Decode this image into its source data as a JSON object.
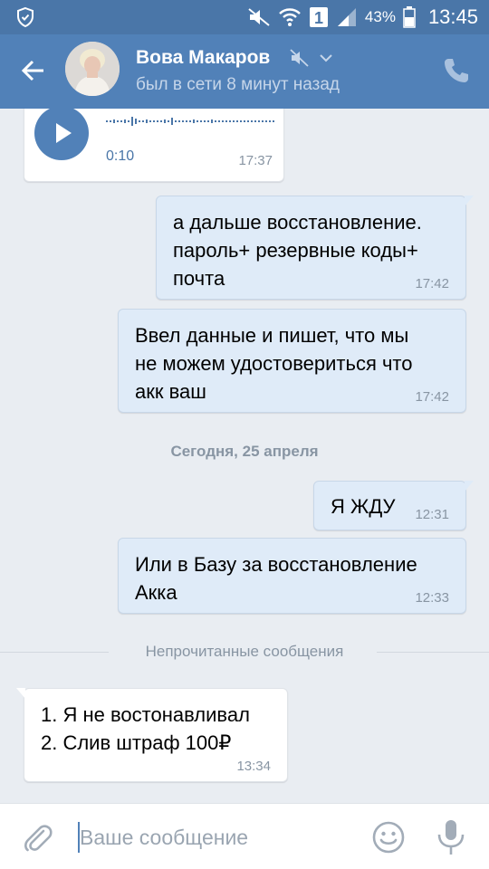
{
  "status_bar": {
    "battery_percent": "43%",
    "time": "13:45",
    "sim_label": "1"
  },
  "header": {
    "name": "Вова Макаров",
    "status": "был в сети 8 минут назад"
  },
  "messages": [
    {
      "type": "voice",
      "duration": "0:10",
      "time": "17:37"
    },
    {
      "type": "out",
      "text": "а дальше восстановление.\nпароль+ резервные коды+\nпочта",
      "time": "17:42"
    },
    {
      "type": "out",
      "text": "Ввел данные и пишет, что мы\nне можем удостовериться что\nакк ваш",
      "time": "17:42"
    },
    {
      "type": "date",
      "text": "Сегодня, 25 апреля"
    },
    {
      "type": "out",
      "text": "Я ЖДУ",
      "time": "12:31"
    },
    {
      "type": "out",
      "text": "Или в Базу за восстановление\nАкка",
      "time": "12:33"
    },
    {
      "type": "unread",
      "text": "Непрочитанные сообщения"
    },
    {
      "type": "in",
      "text": "1. Я не востонавливал\n2. Слив штраф 100₽",
      "time": "13:34"
    }
  ],
  "input": {
    "placeholder": "Ваше сообщение"
  },
  "colors": {
    "header": "#5181b8",
    "status_bar": "#4a76a8",
    "outgoing_bubble": "#dfebf8",
    "incoming_bubble": "#ffffff",
    "chat_background": "#e9edf2"
  }
}
